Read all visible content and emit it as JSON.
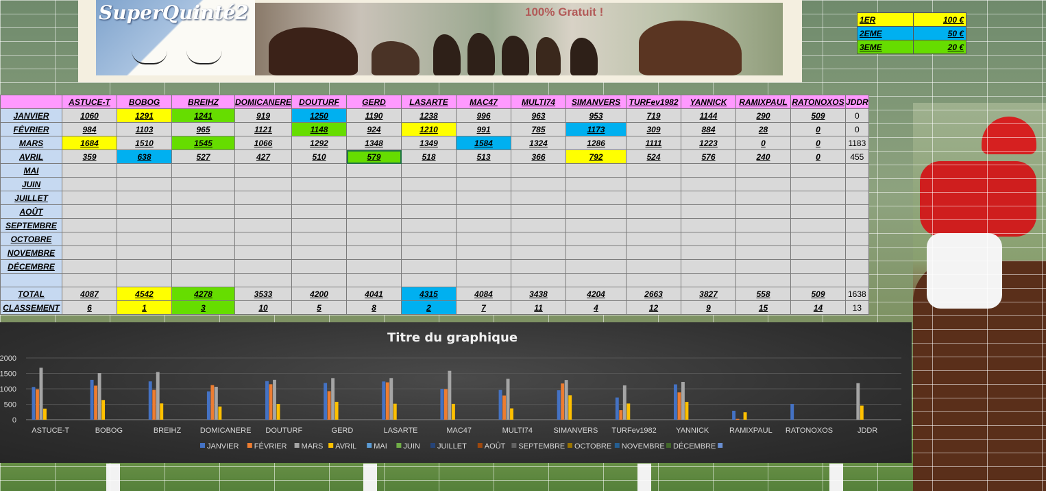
{
  "banner": {
    "logo": "SuperQuinté2",
    "tagline": "100% Gratuit !"
  },
  "prizes": [
    {
      "place": "1ER",
      "amount": "100 €",
      "color": "#ffff00"
    },
    {
      "place": "2EME",
      "amount": "50 €",
      "color": "#00b0f0"
    },
    {
      "place": "3EME",
      "amount": "20 €",
      "color": "#66dd00"
    }
  ],
  "players": [
    "ASTUCE-T",
    "BOBOG",
    "BREIHZ",
    "DOMICANERE",
    "DOUTURF",
    "GERD",
    "LASARTE",
    "MAC47",
    "MULTI74",
    "SIMANVERS",
    "TURFev1982",
    "YANNICK",
    "RAMIXPAUL",
    "RATONOXOS",
    "JDDR"
  ],
  "months": [
    "JANVIER",
    "FÉVRIER",
    "MARS",
    "AVRIL",
    "MAI",
    "JUIN",
    "JUILLET",
    "AOÛT",
    "SEPTEMBRE",
    "OCTOBRE",
    "NOVEMBRE",
    "DÉCEMBRE"
  ],
  "scores": {
    "JANVIER": [
      "1060",
      "1291",
      "1241",
      "919",
      "1250",
      "1190",
      "1238",
      "996",
      "963",
      "953",
      "719",
      "1144",
      "290",
      "509",
      "0"
    ],
    "FÉVRIER": [
      "984",
      "1103",
      "965",
      "1121",
      "1148",
      "924",
      "1210",
      "991",
      "785",
      "1173",
      "309",
      "884",
      "28",
      "0",
      "0"
    ],
    "MARS": [
      "1684",
      "1510",
      "1545",
      "1066",
      "1292",
      "1348",
      "1349",
      "1584",
      "1324",
      "1286",
      "1111",
      "1223",
      "0",
      "0",
      "1183"
    ],
    "AVRIL": [
      "359",
      "638",
      "527",
      "427",
      "510",
      "579",
      "518",
      "513",
      "366",
      "792",
      "524",
      "576",
      "240",
      "0",
      "455"
    ]
  },
  "highlights": {
    "JANVIER": {
      "1": "yellow",
      "2": "green",
      "4": "blue"
    },
    "FÉVRIER": {
      "4": "green",
      "6": "yellow",
      "9": "blue"
    },
    "MARS": {
      "0": "yellow",
      "2": "green",
      "7": "blue"
    },
    "AVRIL": {
      "1": "blue",
      "5": "green",
      "9": "yellow"
    },
    "TOTAL": {
      "1": "yellow",
      "2": "green",
      "6": "blue"
    },
    "CLASSEMENT": {
      "1": "yellow",
      "2": "green",
      "6": "blue"
    }
  },
  "total_label": "TOTAL",
  "totals": [
    "4087",
    "4542",
    "4278",
    "3533",
    "4200",
    "4041",
    "4315",
    "4084",
    "3438",
    "4204",
    "2663",
    "3827",
    "558",
    "509",
    "1638"
  ],
  "rank_label": "CLASSEMENT",
  "ranks": [
    "6",
    "1",
    "3",
    "10",
    "5",
    "8",
    "2",
    "7",
    "11",
    "4",
    "12",
    "9",
    "15",
    "14",
    "13"
  ],
  "colors": {
    "header_pink": "#ff99ff",
    "row_head_blue": "#c6d9f1",
    "cell_gray": "#d9d9d9",
    "first_yellow": "#ffff00",
    "second_blue": "#00b0f0",
    "third_green": "#66dd00"
  },
  "chart_data": {
    "type": "bar",
    "title": "Titre du graphique",
    "categories": [
      "ASTUCE-T",
      "BOBOG",
      "BREIHZ",
      "DOMICANERE",
      "DOUTURF",
      "GERD",
      "LASARTE",
      "MAC47",
      "MULTI74",
      "SIMANVERS",
      "TURFev1982",
      "YANNICK",
      "RAMIXPAUL",
      "RATONOXOS",
      "JDDR"
    ],
    "yticks": [
      "0",
      "500",
      "1000",
      "1500",
      "2000"
    ],
    "ylim": [
      0,
      2000
    ],
    "grid": true,
    "legend_position": "bottom",
    "series": [
      {
        "name": "JANVIER",
        "color": "#4472c4",
        "values": [
          1060,
          1291,
          1241,
          919,
          1250,
          1190,
          1238,
          996,
          963,
          953,
          719,
          1144,
          290,
          509,
          0
        ]
      },
      {
        "name": "FÉVRIER",
        "color": "#ed7d31",
        "values": [
          984,
          1103,
          965,
          1121,
          1148,
          924,
          1210,
          991,
          785,
          1173,
          309,
          884,
          28,
          0,
          0
        ]
      },
      {
        "name": "MARS",
        "color": "#a5a5a5",
        "values": [
          1684,
          1510,
          1545,
          1066,
          1292,
          1348,
          1349,
          1584,
          1324,
          1286,
          1111,
          1223,
          0,
          0,
          1183
        ]
      },
      {
        "name": "AVRIL",
        "color": "#ffc000",
        "values": [
          359,
          638,
          527,
          427,
          510,
          579,
          518,
          513,
          366,
          792,
          524,
          576,
          240,
          0,
          455
        ]
      },
      {
        "name": "MAI",
        "color": "#5b9bd5",
        "values": [
          0,
          0,
          0,
          0,
          0,
          0,
          0,
          0,
          0,
          0,
          0,
          0,
          0,
          0,
          0
        ]
      },
      {
        "name": "JUIN",
        "color": "#70ad47",
        "values": [
          0,
          0,
          0,
          0,
          0,
          0,
          0,
          0,
          0,
          0,
          0,
          0,
          0,
          0,
          0
        ]
      },
      {
        "name": "JUILLET",
        "color": "#264478",
        "values": [
          0,
          0,
          0,
          0,
          0,
          0,
          0,
          0,
          0,
          0,
          0,
          0,
          0,
          0,
          0
        ]
      },
      {
        "name": "AOÛT",
        "color": "#9e480e",
        "values": [
          0,
          0,
          0,
          0,
          0,
          0,
          0,
          0,
          0,
          0,
          0,
          0,
          0,
          0,
          0
        ]
      },
      {
        "name": "SEPTEMBRE",
        "color": "#636363",
        "values": [
          0,
          0,
          0,
          0,
          0,
          0,
          0,
          0,
          0,
          0,
          0,
          0,
          0,
          0,
          0
        ]
      },
      {
        "name": "OCTOBRE",
        "color": "#997300",
        "values": [
          0,
          0,
          0,
          0,
          0,
          0,
          0,
          0,
          0,
          0,
          0,
          0,
          0,
          0,
          0
        ]
      },
      {
        "name": "NOVEMBRE",
        "color": "#255e91",
        "values": [
          0,
          0,
          0,
          0,
          0,
          0,
          0,
          0,
          0,
          0,
          0,
          0,
          0,
          0,
          0
        ]
      },
      {
        "name": "DÉCEMBRE",
        "color": "#43682b",
        "values": [
          0,
          0,
          0,
          0,
          0,
          0,
          0,
          0,
          0,
          0,
          0,
          0,
          0,
          0,
          0
        ]
      },
      {
        "name": "",
        "color": "#698ed0",
        "values": [
          0,
          0,
          0,
          0,
          0,
          0,
          0,
          0,
          0,
          0,
          0,
          0,
          0,
          0,
          0
        ]
      }
    ]
  }
}
